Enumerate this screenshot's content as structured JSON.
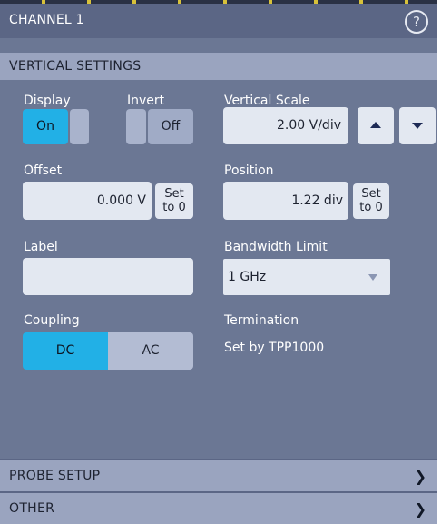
{
  "header": {
    "title": "CHANNEL 1",
    "help_icon": "question-circle-icon",
    "help_glyph": "?"
  },
  "section": {
    "title": "VERTICAL SETTINGS"
  },
  "display": {
    "label": "Display",
    "on_label": "On"
  },
  "invert": {
    "label": "Invert",
    "off_label": "Off"
  },
  "vertical_scale": {
    "label": "Vertical Scale",
    "value": "2.00 V/div"
  },
  "offset": {
    "label": "Offset",
    "value": "0.000 V",
    "set_to_zero_line1": "Set",
    "set_to_zero_line2": "to 0"
  },
  "position": {
    "label": "Position",
    "value": "1.22 div",
    "set_to_zero_line1": "Set",
    "set_to_zero_line2": "to 0"
  },
  "label_field": {
    "label": "Label",
    "value": ""
  },
  "bandwidth": {
    "label": "Bandwidth Limit",
    "selected": "1 GHz"
  },
  "coupling": {
    "label": "Coupling",
    "options": [
      "DC",
      "AC"
    ],
    "selected": "DC"
  },
  "termination": {
    "label": "Termination",
    "value": "Set by TPP1000"
  },
  "footer": {
    "probe_setup": "PROBE SETUP",
    "other": "OTHER",
    "chevron_glyph": "❯"
  },
  "colors": {
    "panel_bg": "#6b7794",
    "section_bar": "#9aa4bf",
    "active_blue": "#22b0e6",
    "field_bg": "#e3e8f1"
  }
}
